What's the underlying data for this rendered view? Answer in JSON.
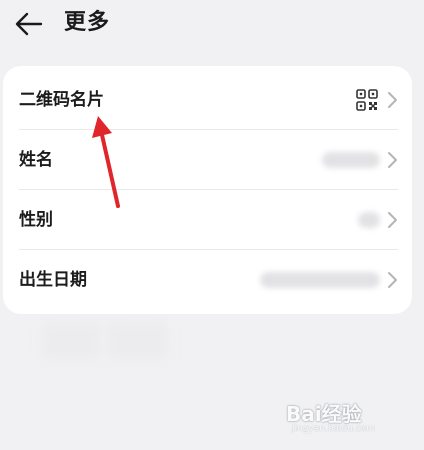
{
  "header": {
    "title": "更多"
  },
  "rows": [
    {
      "label": "二维码名片",
      "value_kind": "qr-icon"
    },
    {
      "label": "姓名",
      "value_kind": "blurred"
    },
    {
      "label": "性别",
      "value_kind": "blurred"
    },
    {
      "label": "出生日期",
      "value_kind": "blurred"
    }
  ],
  "annotation": {
    "arrow_color": "#e0262b"
  },
  "watermark": {
    "logo_text": "Bai经验",
    "url_text": "jingyan.baidu.com"
  },
  "colors": {
    "background": "#f1f1f3",
    "card": "#ffffff",
    "text": "#1a1a1a"
  }
}
